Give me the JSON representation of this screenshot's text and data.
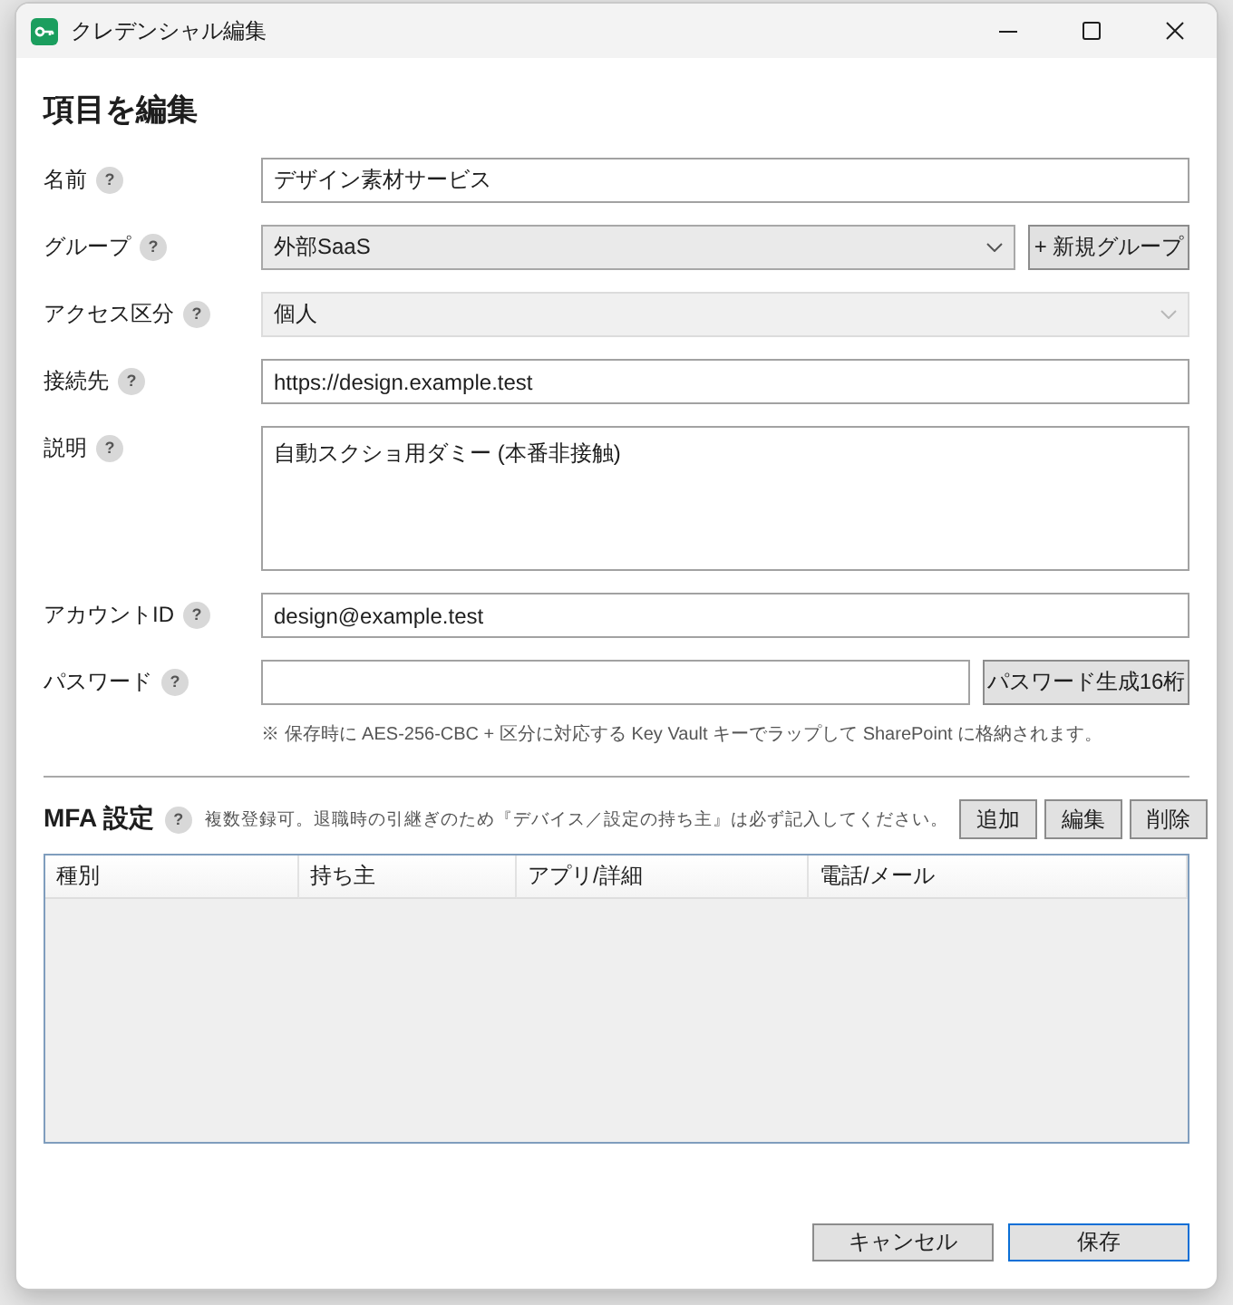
{
  "window": {
    "title": "クレデンシャル編集"
  },
  "heading": "項目を編集",
  "fields": [
    {
      "kind": "text",
      "label": "名前",
      "help": "?",
      "value": "デザイン素材サービス"
    },
    {
      "kind": "select",
      "label": "グループ",
      "help": "?",
      "value": "外部SaaS",
      "disabled": false,
      "button": "+ 新規グループ"
    },
    {
      "kind": "select",
      "label": "アクセス区分",
      "help": "?",
      "value": "個人",
      "disabled": true
    },
    {
      "kind": "text",
      "label": "接続先",
      "help": "?",
      "value": "https://design.example.test"
    },
    {
      "kind": "textarea",
      "label": "説明",
      "help": "?",
      "value": "自動スクショ用ダミー (本番非接触)"
    },
    {
      "kind": "text",
      "label": "アカウントID",
      "help": "?",
      "value": "design@example.test"
    },
    {
      "kind": "password",
      "label": "パスワード",
      "help": "?",
      "button": "パスワード生成16桁"
    }
  ],
  "note": "※ 保存時に AES-256-CBC + 区分に対応する Key Vault キーでラップして SharePoint に格納されます。",
  "mfa": {
    "title": "MFA 設定",
    "help": "?",
    "hint": "複数登録可。退職時の引継ぎのため『デバイス／設定の持ち主』は必ず記入してください。",
    "buttons": [
      "追加",
      "編集",
      "削除"
    ],
    "table": {
      "columns": [
        "種別",
        "持ち主",
        "アプリ/詳細",
        "電話/メール"
      ]
    }
  },
  "footer": {
    "buttons": [
      {
        "label": "キャンセル",
        "default": false
      },
      {
        "label": "保存",
        "default": true
      }
    ]
  }
}
